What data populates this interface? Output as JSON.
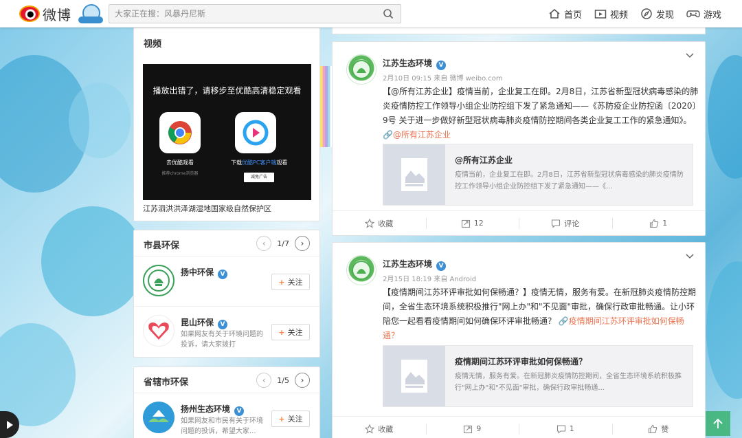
{
  "topbar": {
    "logo_text": "微博",
    "search_placeholder": "大家正在搜：风暴丹尼斯",
    "nav": [
      {
        "label": "首页",
        "icon": "home-icon"
      },
      {
        "label": "视频",
        "icon": "video-icon"
      },
      {
        "label": "发现",
        "icon": "discover-icon"
      },
      {
        "label": "游戏",
        "icon": "game-icon"
      }
    ]
  },
  "video_card": {
    "title": "视频",
    "error_message": "播放出错了，请移步至优酷高清稳定观看",
    "option1_label": "去优酷观看",
    "option1_sub": "推荐chrome浏览器",
    "option2_label_pre": "下载",
    "option2_label_link": "优酷PC客户端",
    "option2_label_post": "观看",
    "ad_button": "减免广告",
    "caption": "江苏泗洪洪泽湖湿地国家级自然保护区"
  },
  "city_card": {
    "title": "市县环保",
    "page": "1/7",
    "items": [
      {
        "name": "扬中环保",
        "desc": "",
        "follow": "关注"
      },
      {
        "name": "昆山环保",
        "desc": "如果网友有关于环境问题的投诉，请大家拨打",
        "follow": "关注"
      }
    ]
  },
  "prov_card": {
    "title": "省辖市环保",
    "page": "1/5",
    "items": [
      {
        "name": "扬州生态环境",
        "desc": "如果网友和市民有关于环境问题的投诉，希望大家...",
        "follow": "关注"
      }
    ]
  },
  "posts": [
    {
      "author": "江苏生态环境",
      "meta": "2月10日 09:15 来自 微博 weibo.com",
      "text": "【@所有江苏企业】疫情当前，企业复工在即。2月8日，江苏省新型冠状病毒感染的肺炎疫情防控工作领导小组企业防控组下发了紧急通知——《苏防疫企业防控函〔2020〕9号 关于进一步做好新型冠状病毒肺炎疫情防控期间各类企业复工工作的紧急通知》。",
      "link": "@所有江苏企业",
      "card_title": "@所有江苏企业",
      "card_desc": "疫情当前，企业复工在即。2月8日，江苏省新型冠状病毒感染的肺炎疫情防控工作领导小组企业防控组下发了紧急通知——《...",
      "actions": {
        "fav": "收藏",
        "share": "12",
        "comment": "评论",
        "like": "1"
      }
    },
    {
      "author": "江苏生态环境",
      "meta": "2月15日 18:19 来自 Android",
      "text": "【疫情期间江苏环评审批如何保畅通？】疫情无情，服务有爱。在新冠肺炎疫情防控期间，全省生态环境系统积极推行\"网上办\"和\"不见面\"审批，确保行政审批畅通。让小环陪您一起看看疫情期间如何确保环评审批畅通？",
      "link": "疫情期间江苏环评审批如何保畅通？",
      "card_title": "疫情期间江苏环评审批如何保畅通？",
      "card_desc": "疫情无情，服务有爱。在新冠肺炎疫情防控期间，全省生态环境系统积极推行\"网上办\"和\"不见面\"审批，确保行政审批畅通...",
      "actions": {
        "fav": "收藏",
        "share": "9",
        "comment": "1",
        "like": "赞"
      }
    }
  ],
  "colors": {
    "accent_orange": "#eb7350",
    "verified_blue": "#3a8fd6",
    "weibo_red": "#e6162d"
  }
}
